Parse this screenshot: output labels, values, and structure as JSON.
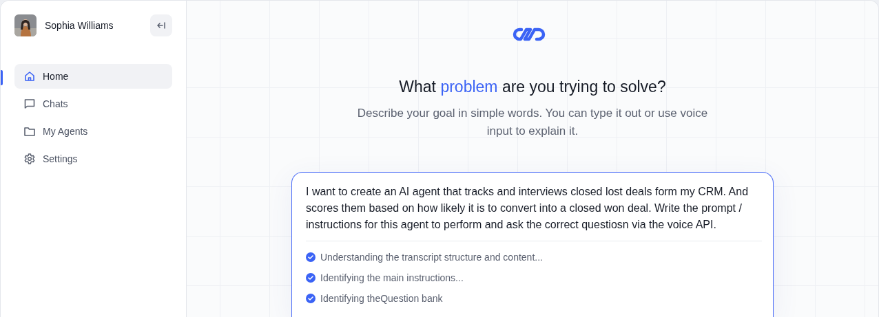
{
  "user": {
    "name": "Sophia Williams"
  },
  "nav": [
    {
      "label": "Home",
      "selected": true
    },
    {
      "label": "Chats",
      "selected": false
    },
    {
      "label": "My Agents",
      "selected": false
    },
    {
      "label": "Settings",
      "selected": false
    }
  ],
  "heading": [
    {
      "text": "What ",
      "highlight": false
    },
    {
      "text": "problem",
      "highlight": true
    },
    {
      "text": " are you trying to solve?",
      "highlight": false
    }
  ],
  "subtitle": "Describe your goal in simple words. You can type it out or use voice input to explain it.",
  "prompt": "I want to create an AI agent that tracks and interviews closed lost deals form my CRM. And scores them based on how likely it is to convert into a closed won deal. Write the prompt / instructions for this agent to perform and ask the correct questiosn via the voice API.",
  "steps": [
    {
      "label": "Understanding the transcript structure and content...",
      "done": true
    },
    {
      "label": "Identifying the main instructions...",
      "done": true
    },
    {
      "label": "Identifying theQuestion bank",
      "done": true
    }
  ]
}
